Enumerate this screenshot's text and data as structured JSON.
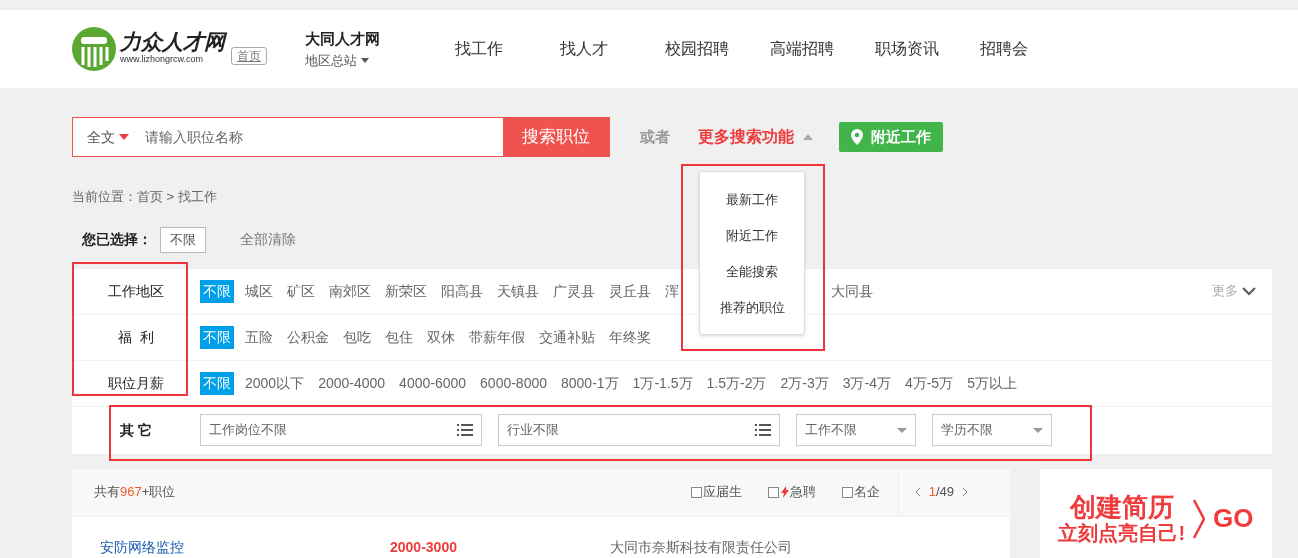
{
  "header": {
    "logo_text": "力众人才网",
    "logo_url": "www.lizhongrcw.com",
    "home_tag": "首页",
    "site_name": "大同人才网",
    "station": "地区总站",
    "nav": [
      {
        "label": "找工作"
      },
      {
        "label": "找人才"
      },
      {
        "label": "校园招聘"
      },
      {
        "label": "高端招聘"
      },
      {
        "label": "职场资讯"
      },
      {
        "label": "招聘会"
      }
    ]
  },
  "search": {
    "scope": "全文",
    "placeholder": "请输入职位名称",
    "button": "搜索职位",
    "or_text": "或者",
    "more": "更多搜索功能",
    "nearby_button": "附近工作"
  },
  "more_menu": {
    "expanded": true,
    "items": [
      "最新工作",
      "附近工作",
      "全能搜索",
      "推荐的职位"
    ]
  },
  "breadcrumb": "当前位置：首页 > 找工作",
  "selection": {
    "label": "您已选择：",
    "tags": [
      "不限"
    ],
    "clear": "全部清除"
  },
  "filters": [
    {
      "label": "工作地区",
      "more": "更多",
      "options": [
        {
          "label": "不限",
          "selected": true
        },
        {
          "label": "城区",
          "selected": false
        },
        {
          "label": "矿区",
          "selected": false
        },
        {
          "label": "南郊区",
          "selected": false
        },
        {
          "label": "新荣区",
          "selected": false
        },
        {
          "label": "阳高县",
          "selected": false
        },
        {
          "label": "天镇县",
          "selected": false
        },
        {
          "label": "广灵县",
          "selected": false
        },
        {
          "label": "灵丘县",
          "selected": false
        },
        {
          "label": "浑",
          "selected": false
        },
        {
          "label": "大同县",
          "selected": false
        }
      ]
    },
    {
      "label": "福  利",
      "options": [
        {
          "label": "不限",
          "selected": true
        },
        {
          "label": "五险",
          "selected": false
        },
        {
          "label": "公积金",
          "selected": false
        },
        {
          "label": "包吃",
          "selected": false
        },
        {
          "label": "包住",
          "selected": false
        },
        {
          "label": "双休",
          "selected": false
        },
        {
          "label": "带薪年假",
          "selected": false
        },
        {
          "label": "交通补贴",
          "selected": false
        },
        {
          "label": "年终奖",
          "selected": false
        }
      ]
    },
    {
      "label": "职位月薪",
      "options": [
        {
          "label": "不限",
          "selected": true
        },
        {
          "label": "2000以下",
          "selected": false
        },
        {
          "label": "2000-4000",
          "selected": false
        },
        {
          "label": "4000-6000",
          "selected": false
        },
        {
          "label": "6000-8000",
          "selected": false
        },
        {
          "label": "8000-1万",
          "selected": false
        },
        {
          "label": "1万-1.5万",
          "selected": false
        },
        {
          "label": "1.5万-2万",
          "selected": false
        },
        {
          "label": "2万-3万",
          "selected": false
        },
        {
          "label": "3万-4万",
          "selected": false
        },
        {
          "label": "4万-5万",
          "selected": false
        },
        {
          "label": "5万以上",
          "selected": false
        }
      ]
    }
  ],
  "other": {
    "label": "其 它",
    "fields": [
      {
        "kind": "list",
        "value": "工作岗位不限"
      },
      {
        "kind": "list",
        "value": "行业不限"
      },
      {
        "kind": "select",
        "value": "工作不限"
      },
      {
        "kind": "select",
        "value": "学历不限"
      }
    ]
  },
  "results": {
    "prefix": "共有",
    "count": "967",
    "suffix": "+职位",
    "checks": [
      {
        "label": "应届生",
        "checked": false,
        "urgent": false
      },
      {
        "label": "急聘",
        "checked": false,
        "urgent": true
      },
      {
        "label": "名企",
        "checked": false,
        "urgent": false
      }
    ],
    "page_current": "1",
    "page_total": "/49",
    "rows": [
      {
        "title": "安防网络监控",
        "salary": "2000-3000",
        "company": "大同市奈斯科技有限责任公司"
      }
    ]
  },
  "ad": {
    "line1": "创建简历",
    "line2": "立刻点亮自己!",
    "go": "GO"
  }
}
